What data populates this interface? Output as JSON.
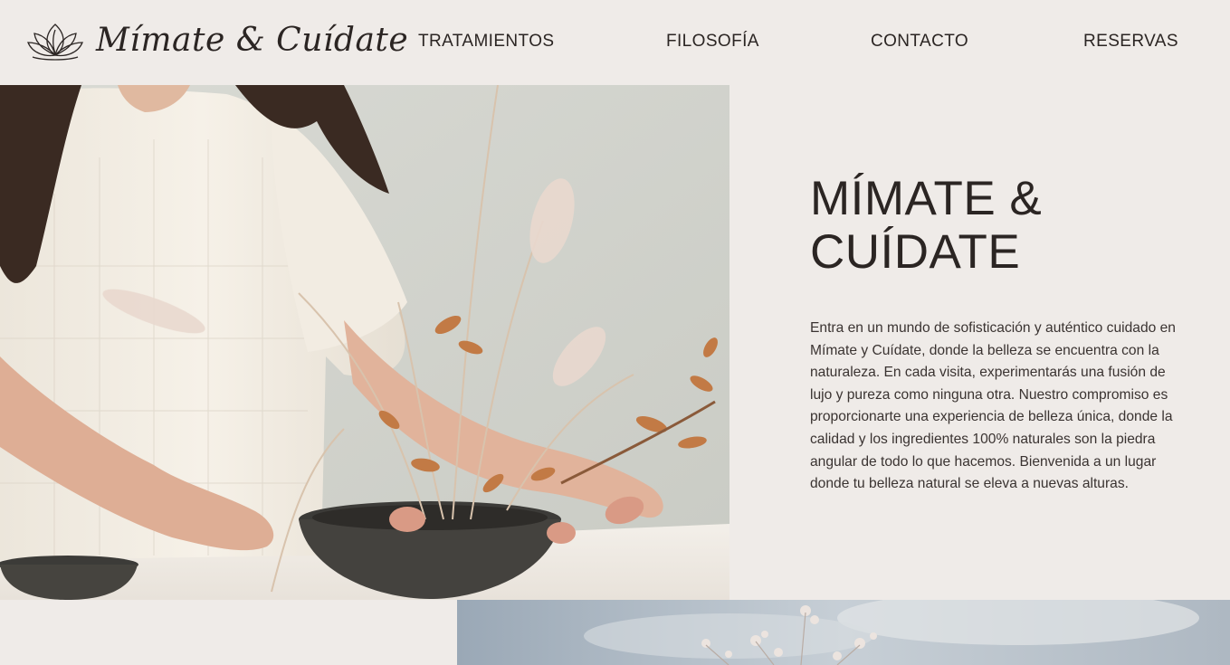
{
  "brand": {
    "name": "Mímate & Cuídate",
    "logo_icon": "lotus-icon"
  },
  "nav": {
    "items": [
      {
        "label": "TRATAMIENTOS"
      },
      {
        "label": "FILOSOFÍA"
      },
      {
        "label": "CONTACTO"
      },
      {
        "label": "RESERVAS"
      }
    ]
  },
  "hero": {
    "title": "MÍMATE &\nCUÍDATE",
    "body": "Entra en un mundo de sofisticación y auténtico cuidado en Mímate y Cuídate, donde la belleza se encuentra con la naturaleza. En cada visita, experimentarás una fusión de lujo y pureza como ninguna otra. Nuestro compromiso es proporcionarte una experiencia de belleza única, donde la calidad y los ingredientes 100% naturales son la piedra angular de todo lo que hacemos. Bienvenida a un lugar donde tu belleza natural se eleva a nuevas alturas.",
    "image": "photo-woman-arranging-dried-flowers-icon"
  },
  "second_section": {
    "image": "photo-dried-flowers-sky-icon"
  },
  "colors": {
    "background": "#efebe8",
    "text": "#2b2523",
    "accent": "#c27a45"
  }
}
